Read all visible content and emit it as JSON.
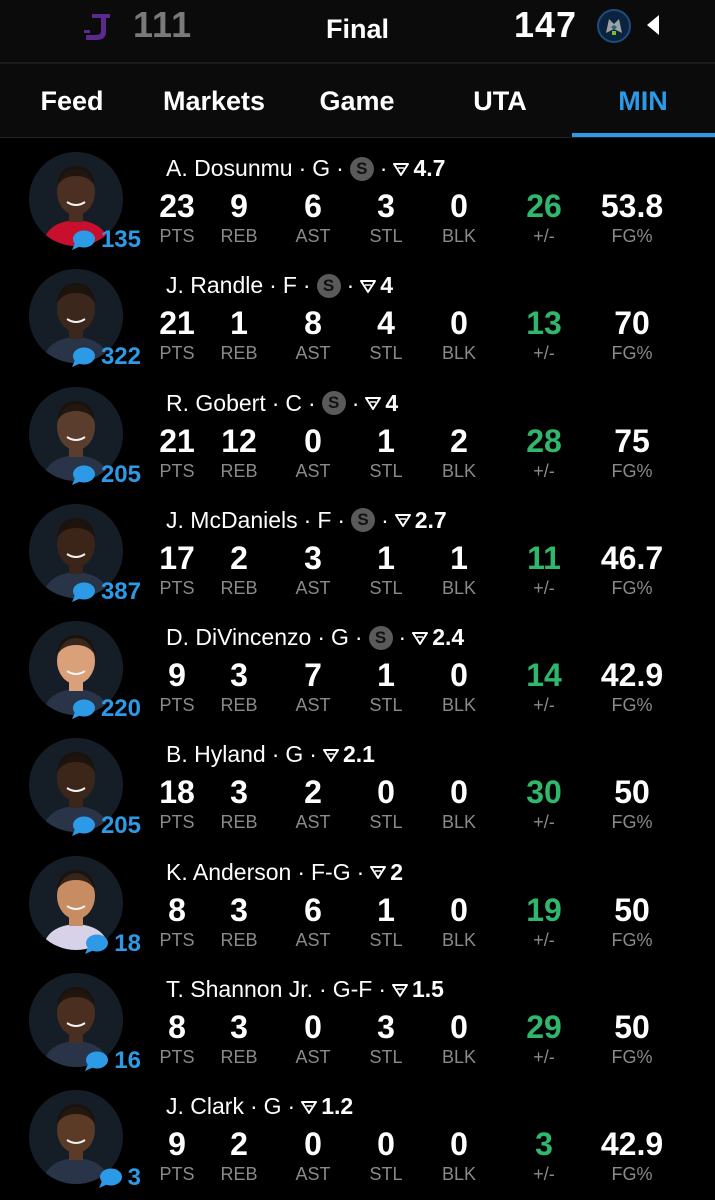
{
  "scoreboard": {
    "away_score": "111",
    "status": "Final",
    "home_score": "147"
  },
  "tabs": [
    "Feed",
    "Markets",
    "Game",
    "UTA",
    "MIN"
  ],
  "active_tab": "MIN",
  "stat_labels": [
    "PTS",
    "REB",
    "AST",
    "STL",
    "BLK",
    "+/-",
    "FG%"
  ],
  "colors": {
    "accent": "#2c9ae6",
    "plus_minus": "#2fb86b",
    "muted": "#8a8a8a"
  },
  "players": [
    {
      "name": "A. Dosunmu",
      "pos": "G",
      "starter": true,
      "proj": "4.7",
      "comments": "135",
      "stats": [
        "23",
        "9",
        "6",
        "3",
        "0",
        "26",
        "53.8"
      ]
    },
    {
      "name": "J. Randle",
      "pos": "F",
      "starter": true,
      "proj": "4",
      "comments": "322",
      "stats": [
        "21",
        "1",
        "8",
        "4",
        "0",
        "13",
        "70"
      ]
    },
    {
      "name": "R. Gobert",
      "pos": "C",
      "starter": true,
      "proj": "4",
      "comments": "205",
      "stats": [
        "21",
        "12",
        "0",
        "1",
        "2",
        "28",
        "75"
      ]
    },
    {
      "name": "J. McDaniels",
      "pos": "F",
      "starter": true,
      "proj": "2.7",
      "comments": "387",
      "stats": [
        "17",
        "2",
        "3",
        "1",
        "1",
        "11",
        "46.7"
      ]
    },
    {
      "name": "D. DiVincenzo",
      "pos": "G",
      "starter": true,
      "proj": "2.4",
      "comments": "220",
      "stats": [
        "9",
        "3",
        "7",
        "1",
        "0",
        "14",
        "42.9"
      ]
    },
    {
      "name": "B. Hyland",
      "pos": "G",
      "starter": false,
      "proj": "2.1",
      "comments": "205",
      "stats": [
        "18",
        "3",
        "2",
        "0",
        "0",
        "30",
        "50"
      ]
    },
    {
      "name": "K. Anderson",
      "pos": "F-G",
      "starter": false,
      "proj": "2",
      "comments": "18",
      "stats": [
        "8",
        "3",
        "6",
        "1",
        "0",
        "19",
        "50"
      ]
    },
    {
      "name": "T. Shannon Jr.",
      "pos": "G-F",
      "starter": false,
      "proj": "1.5",
      "comments": "16",
      "stats": [
        "8",
        "3",
        "0",
        "3",
        "0",
        "29",
        "50"
      ]
    },
    {
      "name": "J. Clark",
      "pos": "G",
      "starter": false,
      "proj": "1.2",
      "comments": "3",
      "stats": [
        "9",
        "2",
        "0",
        "0",
        "0",
        "3",
        "42.9"
      ]
    }
  ],
  "starter_badge": "S",
  "separator": "·"
}
